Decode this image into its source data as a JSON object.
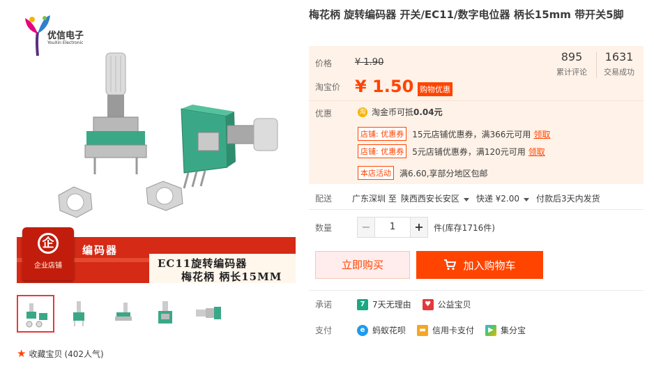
{
  "brand": {
    "name": "优信电子",
    "sub": "YouXin Electronic"
  },
  "gallery": {
    "banner": {
      "badge": "企业店铺",
      "title1": "编码器",
      "title2": "EC11旋转编码器",
      "title3": "梅花柄 柄长15MM"
    },
    "thumbs_count": 5
  },
  "favorite": {
    "label": "收藏宝贝",
    "count": "(402人气)"
  },
  "product": {
    "title": "梅花柄 旋转编码器 开关/EC11/数字电位器 柄长15mm 带开关5脚"
  },
  "price": {
    "label_price": "价格",
    "original": "¥ 1.90",
    "label_taobao": "淘宝价",
    "current": "¥ 1.50",
    "tag": "购物优惠",
    "stats": [
      {
        "num": "895",
        "label": "累计评论"
      },
      {
        "num": "1631",
        "label": "交易成功"
      }
    ]
  },
  "promos": {
    "label": "优惠",
    "coin_icon": "coin-icon",
    "coin_text": "淘金币可抵",
    "coin_amount": "0.04元",
    "coupons": [
      {
        "tag": "店铺: 优惠券",
        "text": "15元店铺优惠券，满366元可用",
        "action": "领取"
      },
      {
        "tag": "店铺: 优惠券",
        "text": "5元店铺优惠券，满120元可用",
        "action": "领取"
      }
    ],
    "activity": {
      "tag": "本店活动",
      "text": "满6.60,享部分地区包邮"
    }
  },
  "shipping": {
    "label": "配送",
    "from": "广东深圳 至",
    "to": "陕西西安长安区",
    "method": "快递 ¥2.00",
    "note": "付款后3天内发货"
  },
  "quantity": {
    "label": "数量",
    "minus": "−",
    "value": "1",
    "plus": "+",
    "stock": "件(库存1716件)"
  },
  "actions": {
    "buy": "立即购买",
    "cart": "加入购物车"
  },
  "promise": {
    "label": "承诺",
    "items": [
      {
        "icon": "seven-day-return-icon",
        "text": "7天无理由"
      },
      {
        "icon": "charity-heart-icon",
        "text": "公益宝贝"
      }
    ]
  },
  "payment": {
    "label": "支付",
    "items": [
      {
        "icon": "huabei-icon",
        "text": "蚂蚁花呗"
      },
      {
        "icon": "credit-card-icon",
        "text": "信用卡支付"
      },
      {
        "icon": "jifenbao-icon",
        "text": "集分宝"
      }
    ]
  },
  "colors": {
    "accent": "#ff4400",
    "price_bg": "#fff2e8",
    "buy_bg": "#ffeded"
  }
}
